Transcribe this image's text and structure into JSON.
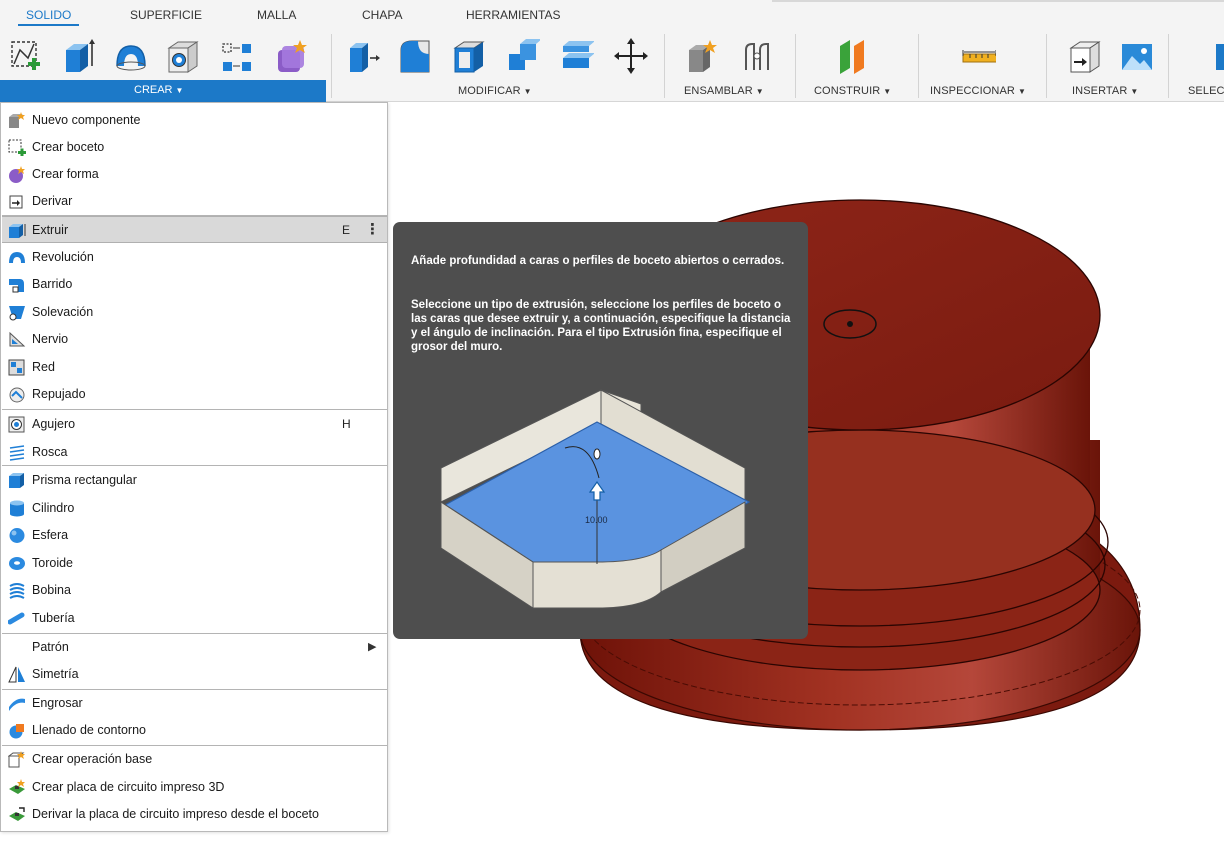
{
  "tabs": [
    {
      "label": "SOLIDO",
      "active": true
    },
    {
      "label": "SUPERFICIE"
    },
    {
      "label": "MALLA"
    },
    {
      "label": "CHAPA"
    },
    {
      "label": "HERRAMIENTAS"
    }
  ],
  "ribbon": {
    "groups": {
      "crear": "CREAR",
      "modificar": "MODIFICAR",
      "ensamblar": "ENSAMBLAR",
      "construir": "CONSTRUIR",
      "inspeccionar": "INSPECCIONAR",
      "insertar": "INSERTAR",
      "seleccionar": "SELEC"
    },
    "accent_color": "#1c79c8"
  },
  "menu": {
    "items": [
      {
        "label": "Nuevo componente",
        "icon": "new-component-icon"
      },
      {
        "label": "Crear boceto",
        "icon": "create-sketch-icon"
      },
      {
        "label": "Crear forma",
        "icon": "create-form-icon"
      },
      {
        "label": "Derivar",
        "icon": "derive-icon"
      },
      {
        "label": "Extruir",
        "icon": "extrude-icon",
        "shortcut": "E",
        "more": "⋮",
        "highlighted": true
      },
      {
        "label": "Revolución",
        "icon": "revolve-icon"
      },
      {
        "label": "Barrido",
        "icon": "sweep-icon"
      },
      {
        "label": "Solevación",
        "icon": "loft-icon"
      },
      {
        "label": "Nervio",
        "icon": "rib-icon"
      },
      {
        "label": "Red",
        "icon": "web-icon"
      },
      {
        "label": "Repujado",
        "icon": "emboss-icon"
      },
      {
        "label": "Agujero",
        "icon": "hole-icon",
        "shortcut": "H"
      },
      {
        "label": "Rosca",
        "icon": "thread-icon"
      },
      {
        "label": "Prisma rectangular",
        "icon": "box-icon"
      },
      {
        "label": "Cilindro",
        "icon": "cylinder-icon"
      },
      {
        "label": "Esfera",
        "icon": "sphere-icon"
      },
      {
        "label": "Toroide",
        "icon": "torus-icon"
      },
      {
        "label": "Bobina",
        "icon": "coil-icon"
      },
      {
        "label": "Tubería",
        "icon": "pipe-icon"
      },
      {
        "label": "Patrón",
        "submenu": true
      },
      {
        "label": "Simetría",
        "icon": "mirror-icon"
      },
      {
        "label": "Engrosar",
        "icon": "thicken-icon"
      },
      {
        "label": "Llenado de contorno",
        "icon": "boundary-fill-icon"
      },
      {
        "label": "Crear operación base",
        "icon": "base-feature-icon"
      },
      {
        "label": "Crear placa de circuito impreso 3D",
        "icon": "pcb-3d-icon"
      },
      {
        "label": "Derivar la placa de circuito impreso desde el boceto",
        "icon": "pcb-derive-icon"
      }
    ]
  },
  "tooltip": {
    "title": "Añade profundidad a caras o perfiles de boceto abiertos o cerrados.",
    "body": "Seleccione un tipo de extrusión, seleccione los perfiles de boceto o las caras que desee extruir y, a continuación, especifique la distancia y el ángulo de inclinación. Para el tipo Extrusión fina, especifique el grosor del muro.",
    "dimension": "10.00"
  }
}
